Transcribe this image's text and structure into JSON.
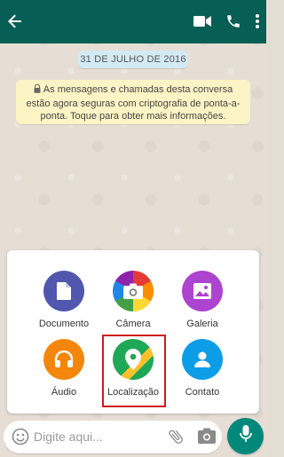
{
  "date_pill": "31 DE JULHO DE 2016",
  "encryption_notice": "As mensagens e chamadas desta conversa estão agora seguras com criptografia de ponta-a-ponta. Toque para obter mais informações.",
  "attachments": [
    {
      "label": "Documento",
      "color": "#5157ae",
      "icon": "document-icon"
    },
    {
      "label": "Câmera",
      "color": "#f0f0f0",
      "icon": "camera-icon"
    },
    {
      "label": "Galeria",
      "color": "#ac44cf",
      "icon": "gallery-icon"
    },
    {
      "label": "Áudio",
      "color": "#f5860c",
      "icon": "headphones-icon"
    },
    {
      "label": "Localização",
      "color": "#1fa855",
      "icon": "location-pin-icon"
    },
    {
      "label": "Contato",
      "color": "#0d9de7",
      "icon": "contact-icon"
    }
  ],
  "composer": {
    "placeholder": "Digite aqui..."
  },
  "colors": {
    "appbar": "#075e54",
    "mic": "#00897b",
    "highlight": "#d11a1a"
  }
}
